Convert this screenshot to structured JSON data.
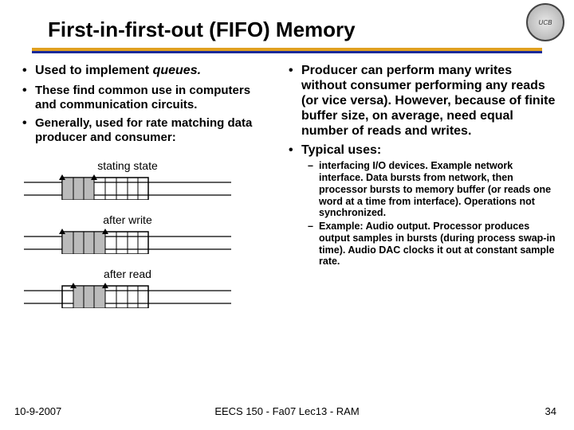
{
  "title": "First-in-first-out (FIFO) Memory",
  "left": {
    "b0": "Used to implement ",
    "b0_it": "queues.",
    "b1": "These find common use in computers and communication circuits.",
    "b2": "Generally, used for rate matching data producer and consumer:"
  },
  "right": {
    "b0": "Producer can perform many writes without consumer performing any reads (or vice versa).   However, because of finite buffer size, on average, need equal number of reads and writes.",
    "b1": "Typical uses:",
    "s0": "interfacing I/O devices.  Example network interface.  Data bursts from network, then processor bursts to memory buffer (or reads one word at a time from interface).  Operations not synchronized.",
    "s1": "Example: Audio output.  Processor produces output samples in bursts (during process swap-in time).  Audio DAC clocks it out at constant sample rate."
  },
  "diag": {
    "l0": "stating state",
    "l1": "after write",
    "l2": "after read"
  },
  "footer": {
    "left": "10-9-2007",
    "center": "EECS 150 - Fa07  Lec13 - RAM",
    "right": "34"
  },
  "seal": "UCB"
}
